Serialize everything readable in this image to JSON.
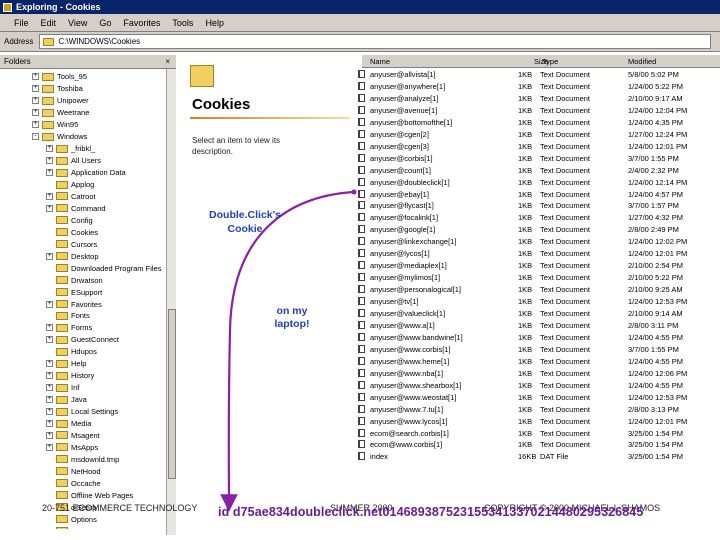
{
  "window": {
    "title": "Exploring - Cookies"
  },
  "menu": [
    "File",
    "Edit",
    "View",
    "Go",
    "Favorites",
    "Tools",
    "Help"
  ],
  "address": {
    "label": "Address",
    "value": "C:\\WINDOWS\\Cookies"
  },
  "folders_pane": {
    "header": "Folders",
    "close_glyph": "×",
    "items": [
      {
        "label": "Tools_95",
        "expander": "+"
      },
      {
        "label": "Toshiba",
        "expander": "+"
      },
      {
        "label": "Unipower",
        "expander": "+"
      },
      {
        "label": "Weetrane",
        "expander": "+"
      },
      {
        "label": "Win95",
        "expander": "+"
      },
      {
        "label": "Windows",
        "expander": "-"
      },
      {
        "label": "_fribkl_",
        "expander": "+"
      },
      {
        "label": "All Users",
        "expander": "+"
      },
      {
        "label": "Application Data",
        "expander": "+"
      },
      {
        "label": "Applog",
        "expander": ""
      },
      {
        "label": "Catroot",
        "expander": "+"
      },
      {
        "label": "Command",
        "expander": "+"
      },
      {
        "label": "Config",
        "expander": ""
      },
      {
        "label": "Cookies",
        "expander": ""
      },
      {
        "label": "Cursors",
        "expander": ""
      },
      {
        "label": "Desktop",
        "expander": "+"
      },
      {
        "label": "Downloaded Program Files",
        "expander": ""
      },
      {
        "label": "Drwatson",
        "expander": ""
      },
      {
        "label": "ESupport",
        "expander": ""
      },
      {
        "label": "Favorites",
        "expander": "+"
      },
      {
        "label": "Fonts",
        "expander": ""
      },
      {
        "label": "Forms",
        "expander": "+"
      },
      {
        "label": "GuestConnect",
        "expander": "+"
      },
      {
        "label": "Hdupos",
        "expander": ""
      },
      {
        "label": "Help",
        "expander": "+"
      },
      {
        "label": "History",
        "expander": "+"
      },
      {
        "label": "Inf",
        "expander": "+"
      },
      {
        "label": "Java",
        "expander": "+"
      },
      {
        "label": "Local Settings",
        "expander": "+"
      },
      {
        "label": "Media",
        "expander": "+"
      },
      {
        "label": "Msagent",
        "expander": "+"
      },
      {
        "label": "MsApps",
        "expander": "+"
      },
      {
        "label": "msdownld.tmp",
        "expander": ""
      },
      {
        "label": "NetHood",
        "expander": ""
      },
      {
        "label": "Occache",
        "expander": ""
      },
      {
        "label": "Offline Web Pages",
        "expander": ""
      },
      {
        "label": "olSetup",
        "expander": ""
      },
      {
        "label": "Options",
        "expander": ""
      },
      {
        "label": "Pavren",
        "expander": ""
      }
    ]
  },
  "web_view": {
    "title": "Cookies",
    "description": "Select an item to view its description."
  },
  "list": {
    "columns": {
      "name": "Name",
      "size": "Size",
      "type": "Type",
      "modified": "Modified"
    },
    "rows": [
      {
        "name": "anyuser@allvista[1]",
        "size": "1KB",
        "type": "Text Document",
        "modified": "5/8/00 5:02 PM"
      },
      {
        "name": "anyuser@anywhere[1]",
        "size": "1KB",
        "type": "Text Document",
        "modified": "1/24/00 5:22 PM"
      },
      {
        "name": "anyuser@analyze[1]",
        "size": "1KB",
        "type": "Text Document",
        "modified": "2/10/00 9:17 AM"
      },
      {
        "name": "anyuser@avenue[1]",
        "size": "1KB",
        "type": "Text Document",
        "modified": "1/24/00 12:04 PM"
      },
      {
        "name": "anyuser@bottomofthe[1]",
        "size": "1KB",
        "type": "Text Document",
        "modified": "1/24/00 4:35 PM"
      },
      {
        "name": "anyuser@cgen[2]",
        "size": "1KB",
        "type": "Text Document",
        "modified": "1/27/00 12:24 PM"
      },
      {
        "name": "anyuser@cgen[3]",
        "size": "1KB",
        "type": "Text Document",
        "modified": "1/24/00 12:01 PM"
      },
      {
        "name": "anyuser@corbis[1]",
        "size": "1KB",
        "type": "Text Document",
        "modified": "3/7/00 1:55 PM"
      },
      {
        "name": "anyuser@count[1]",
        "size": "1KB",
        "type": "Text Document",
        "modified": "2/4/00 2:32 PM"
      },
      {
        "name": "anyuser@doubleclick[1]",
        "size": "1KB",
        "type": "Text Document",
        "modified": "1/24/00 12:14 PM"
      },
      {
        "name": "anyuser@ebay[1]",
        "size": "1KB",
        "type": "Text Document",
        "modified": "1/24/00 4:57 PM"
      },
      {
        "name": "anyuser@flycast[1]",
        "size": "1KB",
        "type": "Text Document",
        "modified": "3/7/00 1:57 PM"
      },
      {
        "name": "anyuser@focalink[1]",
        "size": "1KB",
        "type": "Text Document",
        "modified": "1/27/00 4:32 PM"
      },
      {
        "name": "anyuser@google[1]",
        "size": "1KB",
        "type": "Text Document",
        "modified": "2/8/00 2:49 PM"
      },
      {
        "name": "anyuser@linkexchange[1]",
        "size": "1KB",
        "type": "Text Document",
        "modified": "1/24/00 12:02 PM"
      },
      {
        "name": "anyuser@lycos[1]",
        "size": "1KB",
        "type": "Text Document",
        "modified": "1/24/00 12:01 PM"
      },
      {
        "name": "anyuser@mediaplex[1]",
        "size": "1KB",
        "type": "Text Document",
        "modified": "2/10/00 2:54 PM"
      },
      {
        "name": "anyuser@mylimos[1]",
        "size": "1KB",
        "type": "Text Document",
        "modified": "2/10/00 5:22 PM"
      },
      {
        "name": "anyuser@personalogical[1]",
        "size": "1KB",
        "type": "Text Document",
        "modified": "2/10/00 9:25 AM"
      },
      {
        "name": "anyuser@tv[1]",
        "size": "1KB",
        "type": "Text Document",
        "modified": "1/24/00 12:53 PM"
      },
      {
        "name": "anyuser@valueclick[1]",
        "size": "1KB",
        "type": "Text Document",
        "modified": "2/10/00 9:14 AM"
      },
      {
        "name": "anyuser@www.a[1]",
        "size": "1KB",
        "type": "Text Document",
        "modified": "2/8/00 3:11 PM"
      },
      {
        "name": "anyuser@www.bandwine[1]",
        "size": "1KB",
        "type": "Text Document",
        "modified": "1/24/00 4:55 PM"
      },
      {
        "name": "anyuser@www.corbis[1]",
        "size": "1KB",
        "type": "Text Document",
        "modified": "3/7/00 1:55 PM"
      },
      {
        "name": "anyuser@www.heme[1]",
        "size": "1KB",
        "type": "Text Document",
        "modified": "1/24/00 4:55 PM"
      },
      {
        "name": "anyuser@www.nba[1]",
        "size": "1KB",
        "type": "Text Document",
        "modified": "1/24/00 12:06 PM"
      },
      {
        "name": "anyuser@www.shearbox[1]",
        "size": "1KB",
        "type": "Text Document",
        "modified": "1/24/00 4:55 PM"
      },
      {
        "name": "anyuser@www.weostat[1]",
        "size": "1KB",
        "type": "Text Document",
        "modified": "1/24/00 12:53 PM"
      },
      {
        "name": "anyuser@www.7.tu[1]",
        "size": "1KB",
        "type": "Text Document",
        "modified": "2/8/00 3:13 PM"
      },
      {
        "name": "anyuser@www.lycos[1]",
        "size": "1KB",
        "type": "Text Document",
        "modified": "1/24/00 12:01 PM"
      },
      {
        "name": "ecom@search.corbis[1]",
        "size": "1KB",
        "type": "Text Document",
        "modified": "3/25/00 1:54 PM"
      },
      {
        "name": "ecom@www.corbis[1]",
        "size": "1KB",
        "type": "Text Document",
        "modified": "3/25/00 1:54 PM"
      },
      {
        "name": "index",
        "size": "16KB",
        "type": "DAT File",
        "modified": "3/25/00 1:54 PM"
      }
    ]
  },
  "annotations": {
    "doubleclick_line1": "Double.Click's",
    "doubleclick_line2": "Cookie",
    "laptop_line1": "on my",
    "laptop_line2": "laptop!",
    "cookie_value": "id d75ae834doubleclick.net0146893875231553413370214480295326845"
  },
  "footer": {
    "course": "20-751 ECOMMERCE TECHNOLOGY",
    "term": "SUMMER 2000",
    "copyright": "COPYRIGHT © 2000 MICHAEL I. SHAMOS"
  },
  "colors": {
    "annotation_blue": "#1f3fbf",
    "arrow_purple": "#8a1fa8",
    "titlebar": "#0a246a",
    "chrome": "#d4d0c8"
  }
}
